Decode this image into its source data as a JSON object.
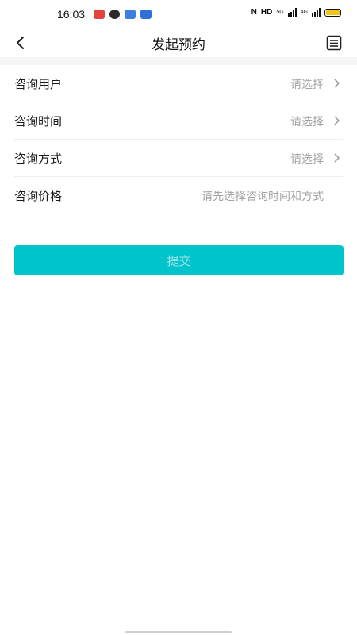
{
  "status": {
    "time": "16:03",
    "network": "HD",
    "signal1": "5G",
    "signal2": "4G"
  },
  "header": {
    "title": "发起预约"
  },
  "form": {
    "rows": [
      {
        "label": "咨询用户",
        "value": "请选择"
      },
      {
        "label": "咨询时间",
        "value": "请选择"
      },
      {
        "label": "咨询方式",
        "value": "请选择"
      },
      {
        "label": "咨询价格",
        "value": "请先选择咨询时间和方式"
      }
    ]
  },
  "actions": {
    "submit_label": "提交"
  },
  "colors": {
    "accent": "#00c4cb",
    "placeholder": "#a3a3a3",
    "battery": "#f0c419"
  },
  "icons": {
    "back": "back-arrow-icon",
    "menu": "document-list-icon",
    "chevron": "chevron-right-icon"
  }
}
